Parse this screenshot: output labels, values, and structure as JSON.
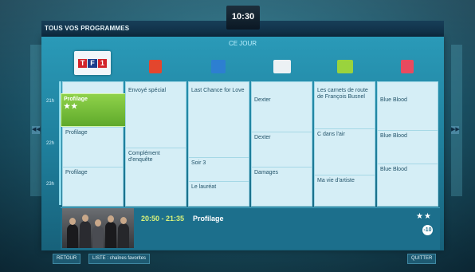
{
  "header": {
    "title": "TOUS VOS PROGRAMMES",
    "clock": "10:30",
    "day": "CE JOUR"
  },
  "hours": [
    "21h",
    "22h",
    "23h"
  ],
  "channels": [
    {
      "logo": "tf1-logo",
      "programs": [
        {
          "title": "Profilage",
          "stars": "★★",
          "selected": true
        },
        {
          "title": "Profilage"
        },
        {
          "title": "Profilage"
        }
      ]
    },
    {
      "logo": "channel-2-logo",
      "programs": [
        {
          "title": "Envoyé spécial"
        },
        {
          "title": "Complément d'enquête"
        }
      ]
    },
    {
      "logo": "channel-3-logo",
      "programs": [
        {
          "title": "Last Chance for Love"
        },
        {
          "title": "Soir 3"
        },
        {
          "title": "Le lauréat"
        }
      ]
    },
    {
      "logo": "canal-plus-logo",
      "programs": [
        {
          "title": "Dexter"
        },
        {
          "title": "Dexter"
        },
        {
          "title": "Damages"
        }
      ]
    },
    {
      "logo": "channel-5-logo",
      "programs": [
        {
          "title": "Les carnets de route de François Busnel"
        },
        {
          "title": "C dans l'air"
        },
        {
          "title": "Ma vie d'artiste"
        }
      ]
    },
    {
      "logo": "m6-logo",
      "programs": [
        {
          "title": "Blue Blood"
        },
        {
          "title": "Blue Blood"
        },
        {
          "title": "Blue Blood"
        }
      ]
    }
  ],
  "info": {
    "time": "20:50 - 21:35",
    "title": "Profilage",
    "stars": "★★",
    "rating": "-10"
  },
  "footer": {
    "back": "RETOUR",
    "favorites": "LISTE : chaînes favorites",
    "quit": "QUITTER"
  },
  "colors": {
    "accent": "#1e7d9a",
    "selection": "#6bb635",
    "time_highlight": "#d8f27a"
  }
}
